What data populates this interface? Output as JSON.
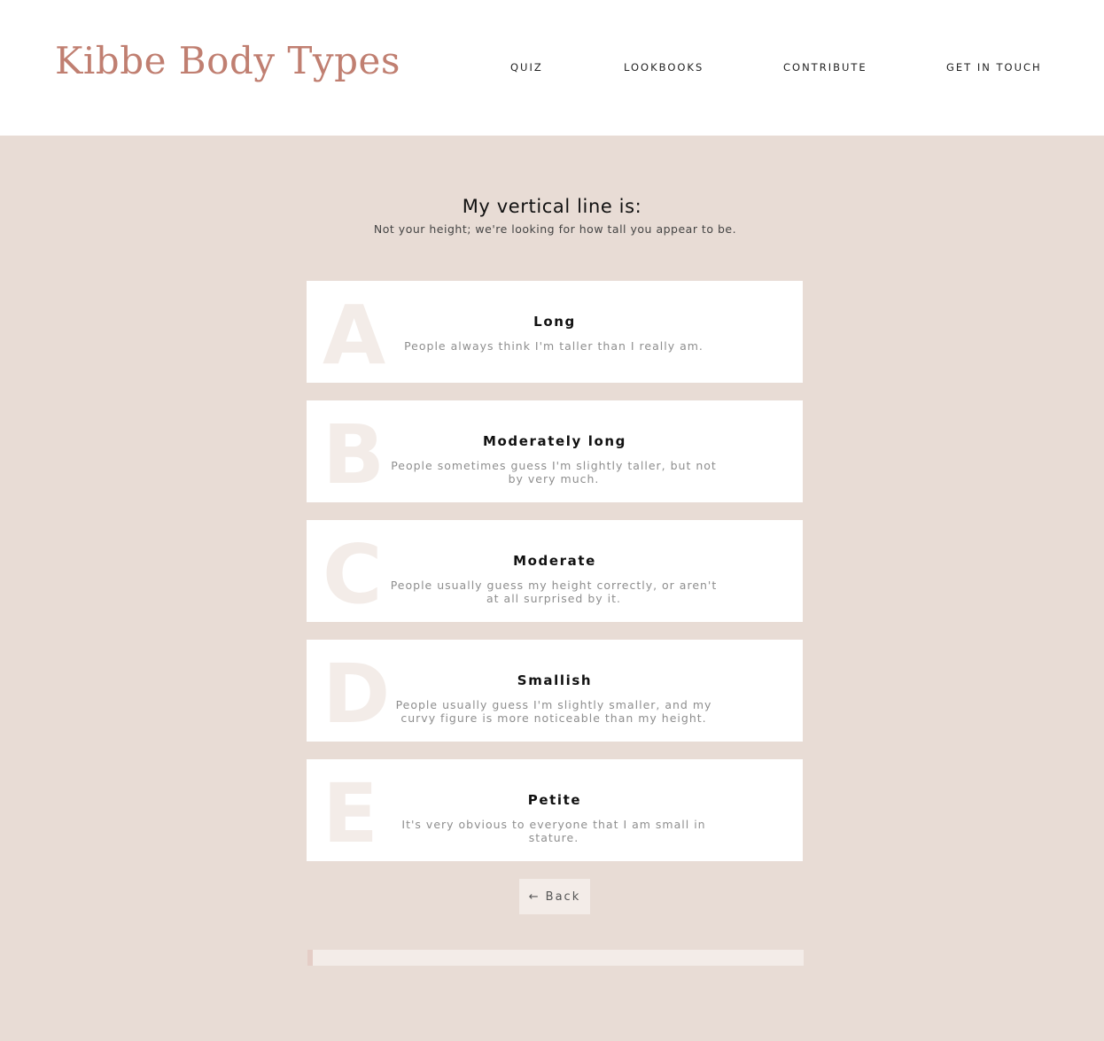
{
  "header": {
    "logo": "Kibbe Body Types",
    "nav": [
      "QUIZ",
      "LOOKBOOKS",
      "CONTRIBUTE",
      "GET IN TOUCH"
    ]
  },
  "question": {
    "title": "My vertical line is:",
    "subtitle": "Not your height; we're looking for how tall you appear to be."
  },
  "options": [
    {
      "letter": "A",
      "title": "Long",
      "description": "People always think I'm taller than I really am."
    },
    {
      "letter": "B",
      "title": "Moderately long",
      "description": "People sometimes guess I'm slightly taller, but not by very much."
    },
    {
      "letter": "C",
      "title": "Moderate",
      "description": "People usually guess my height correctly, or aren't at all surprised by it."
    },
    {
      "letter": "D",
      "title": "Smallish",
      "description": "People usually guess I'm slightly smaller, and my curvy figure is more noticeable than my height."
    },
    {
      "letter": "E",
      "title": "Petite",
      "description": "It's very obvious to everyone that I am small in stature."
    }
  ],
  "back_button": {
    "arrow": "←",
    "label": "Back"
  },
  "progress": {
    "fraction": 0.01
  },
  "colors": {
    "accent": "#c07f71",
    "background": "#e8dcd5",
    "card": "#ffffff",
    "letter": "#f3ece8",
    "progress_fill": "#e4cdc6"
  }
}
